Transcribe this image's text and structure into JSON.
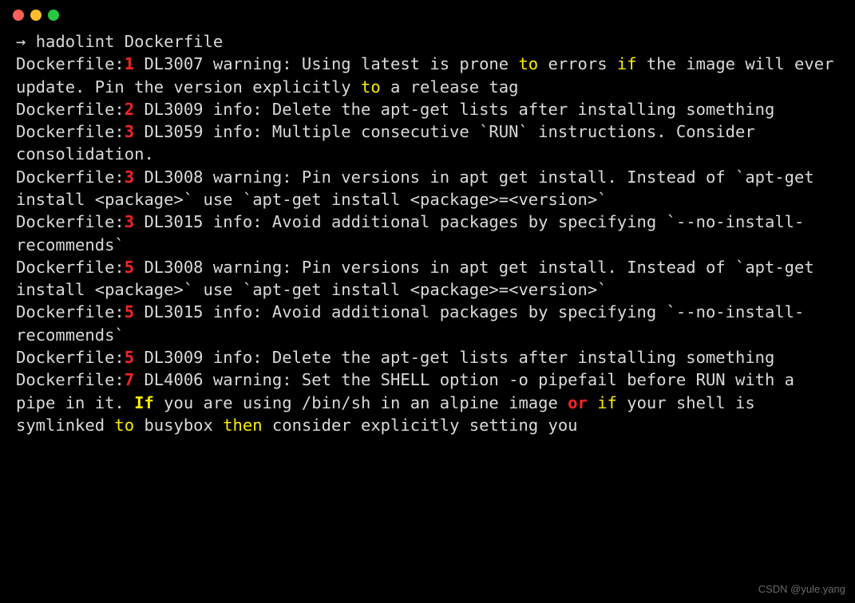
{
  "prompt": {
    "arrow": "→ ",
    "command": "hadolint Dockerfile"
  },
  "lines": [
    {
      "file": "Dockerfile:",
      "num": "1",
      "pre": " DL3007 warning: Using latest is prone ",
      "kw1": "to",
      "mid1": " errors ",
      "kw2": "if",
      "mid2": " the image will ever update. Pin the version explicitly ",
      "kw3": "to",
      "post": " a release tag"
    },
    {
      "file": "Dockerfile:",
      "num": "2",
      "post": " DL3009 info: Delete the apt-get lists after installing something"
    },
    {
      "file": "Dockerfile:",
      "num": "3",
      "post": " DL3059 info: Multiple consecutive `RUN` instructions. Consider consolidation."
    },
    {
      "file": "Dockerfile:",
      "num": "3",
      "post": " DL3008 warning: Pin versions in apt get install. Instead of `apt-get install <package>` use `apt-get install <package>=<version>`"
    },
    {
      "file": "Dockerfile:",
      "num": "3",
      "post": " DL3015 info: Avoid additional packages by specifying `--no-install-recommends`"
    },
    {
      "file": "Dockerfile:",
      "num": "5",
      "post": " DL3008 warning: Pin versions in apt get install. Instead of `apt-get install <package>` use `apt-get install <package>=<version>`"
    },
    {
      "file": "Dockerfile:",
      "num": "5",
      "post": " DL3015 info: Avoid additional packages by specifying `--no-install-recommends`"
    },
    {
      "file": "Dockerfile:",
      "num": "5",
      "post": " DL3009 info: Delete the apt-get lists after installing something"
    },
    {
      "file": "Dockerfile:",
      "num": "7",
      "pre": " DL4006 warning: Set the SHELL option -o pipefail before RUN with a pipe in it. ",
      "kw_if_cap": "If",
      "mid1": " you are using /bin/sh in an alpine image ",
      "kw_or": "or",
      "mid2": " ",
      "kw_if": "if",
      "mid3": " your shell is symlinked ",
      "kw_to": "to",
      "mid4": " busybox ",
      "kw_then": "then",
      "post2": " consider explicitly setting you"
    }
  ],
  "watermark": "CSDN @yule.yang"
}
